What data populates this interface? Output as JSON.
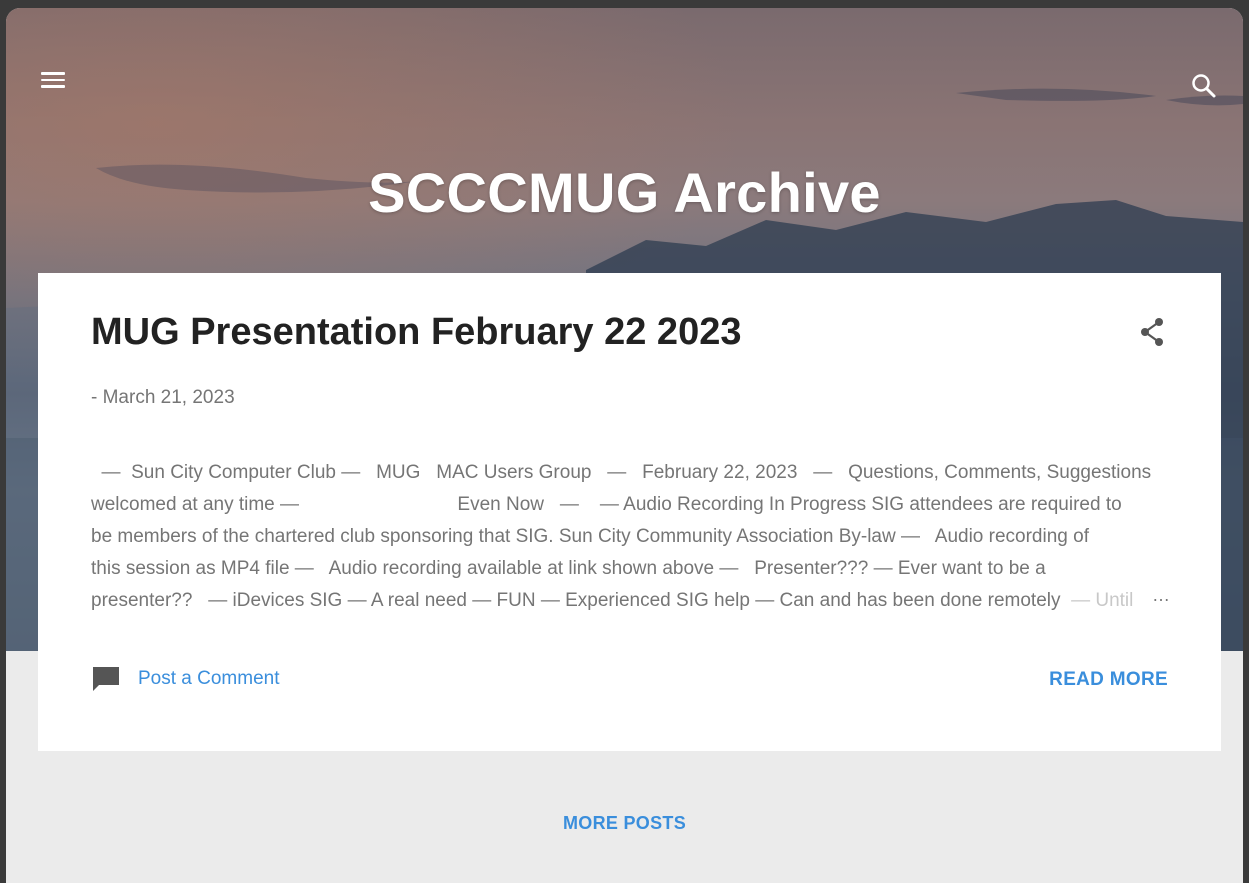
{
  "header": {
    "blog_title": "SCCCMUG Archive",
    "menu_icon": "hamburger-menu-icon",
    "search_icon": "search-icon"
  },
  "post": {
    "title": "MUG Presentation February 22 2023",
    "date": "- March 21, 2023",
    "snippet_lines": [
      "  —  Sun City Computer Club —   MUG   MAC Users Group   —   February 22, 2023   —   Questions, Comments, Suggestions",
      "welcomed at any time —                              Even Now   —    — Audio Recording In Progress SIG attendees are required to",
      "be members of the chartered club sponsoring that SIG. Sun City Community Association By-law —   Audio recording of",
      "this session as MP4 file —   Audio recording available at link shown above —   Presenter??? — Ever want to be a",
      "presenter??   — iDevices SIG — A real need — FUN — Experienced SIG help — Can and has been done remotely  "
    ],
    "snippet_fade": "— Until",
    "ellipsis": "…",
    "share_icon": "share-icon",
    "comment_icon": "comment-icon",
    "comment_label": "Post a Comment",
    "read_more_label": "READ MORE"
  },
  "footer": {
    "more_posts_label": "MORE POSTS"
  },
  "colors": {
    "accent": "#3a8edc",
    "card": "#ffffff",
    "page_bg": "#ebebeb"
  }
}
